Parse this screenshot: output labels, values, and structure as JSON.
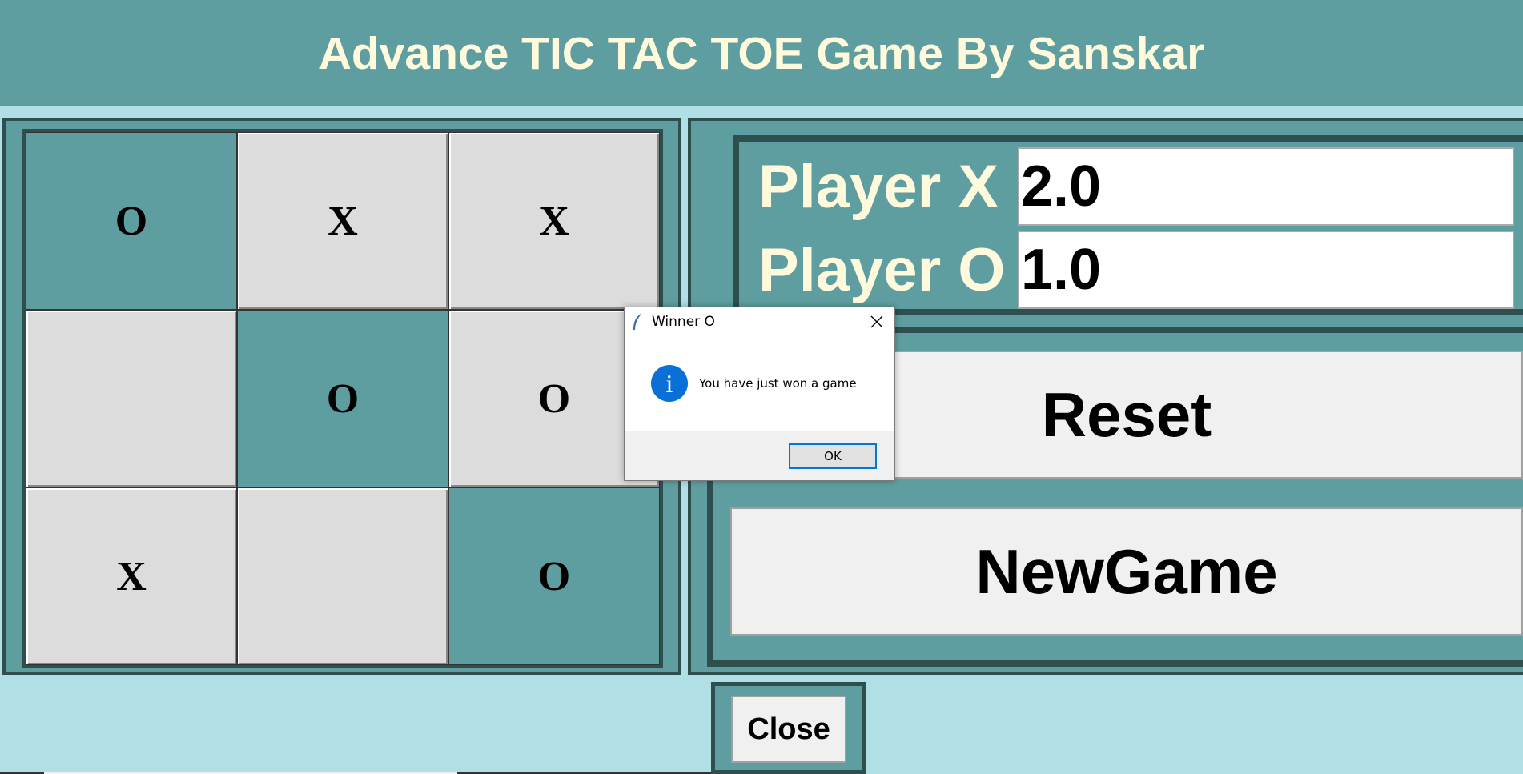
{
  "header": {
    "title": "Advance TIC TAC TOE Game By Sanskar"
  },
  "board": {
    "cells": [
      {
        "mark": "O",
        "winning": true
      },
      {
        "mark": "X",
        "winning": false
      },
      {
        "mark": "X",
        "winning": false
      },
      {
        "mark": "",
        "winning": false
      },
      {
        "mark": "O",
        "winning": true
      },
      {
        "mark": "O",
        "winning": false
      },
      {
        "mark": "X",
        "winning": false
      },
      {
        "mark": "",
        "winning": false
      },
      {
        "mark": "O",
        "winning": true
      }
    ]
  },
  "scores": {
    "player_x_label": "Player X",
    "player_x_value": "2.0",
    "player_o_label": "Player O",
    "player_o_value": "1.0"
  },
  "controls": {
    "reset_label": "Reset",
    "newgame_label": "NewGame",
    "close_label": "Close"
  },
  "dialog": {
    "title": "Winner O",
    "message": "You have just won a game",
    "ok_label": "OK",
    "icon": "info-icon"
  },
  "colors": {
    "accent": "#5f9ea0",
    "background": "#b0dfe5",
    "title_text": "#fffadc",
    "cell_light": "#dcdcdc",
    "border_dark": "#2f4f4f"
  }
}
